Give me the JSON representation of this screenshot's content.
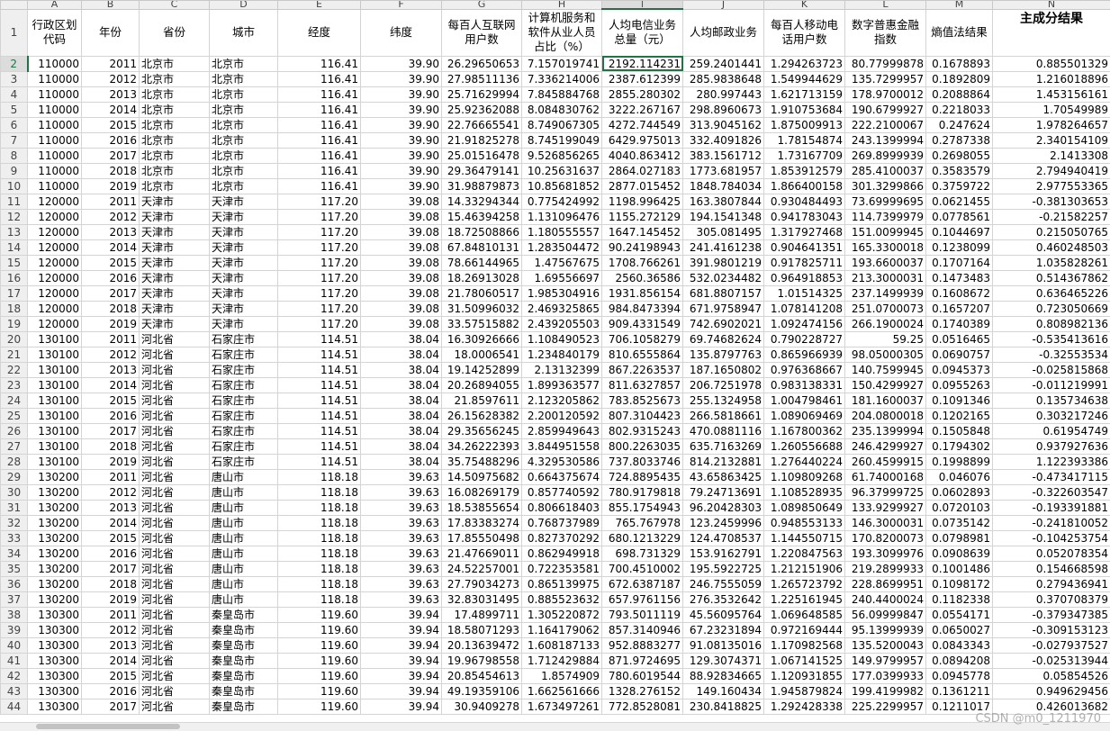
{
  "columns": [
    "",
    "A",
    "B",
    "C",
    "D",
    "E",
    "F",
    "G",
    "H",
    "I",
    "J",
    "K",
    "L",
    "M",
    "N"
  ],
  "selected_column": "I",
  "selected_row": 2,
  "headers": [
    "行政区划代码",
    "年份",
    "省份",
    "城市",
    "经度",
    "纬度",
    "每百人互联网用户数",
    "计算机服务和软件从业人员占比（%）",
    "人均电信业务总量（元）",
    "人均邮政业务",
    "每百人移动电话用户数",
    "数字普惠金融指数",
    "熵值法结果",
    "主成分结果"
  ],
  "rows": [
    [
      "110000",
      "2011",
      "北京市",
      "北京市",
      "116.41",
      "39.90",
      "26.29650653",
      "7.157019741",
      "2192.114231",
      "259.2401441",
      "1.294263723",
      "80.77999878",
      "0.1678893",
      "0.885501329"
    ],
    [
      "110000",
      "2012",
      "北京市",
      "北京市",
      "116.41",
      "39.90",
      "27.98511136",
      "7.336214006",
      "2387.612399",
      "285.9838648",
      "1.549944629",
      "135.7299957",
      "0.1892809",
      "1.216018896"
    ],
    [
      "110000",
      "2013",
      "北京市",
      "北京市",
      "116.41",
      "39.90",
      "25.71629994",
      "7.845884768",
      "2855.280302",
      "280.997443",
      "1.621713159",
      "178.9700012",
      "0.2088864",
      "1.453156161"
    ],
    [
      "110000",
      "2014",
      "北京市",
      "北京市",
      "116.41",
      "39.90",
      "25.92362088",
      "8.084830762",
      "3222.267167",
      "298.8960673",
      "1.910753684",
      "190.6799927",
      "0.2218033",
      "1.70549989"
    ],
    [
      "110000",
      "2015",
      "北京市",
      "北京市",
      "116.41",
      "39.90",
      "22.76665541",
      "8.749067305",
      "4272.744549",
      "313.9045162",
      "1.875009913",
      "222.2100067",
      "0.247624",
      "1.978264657"
    ],
    [
      "110000",
      "2016",
      "北京市",
      "北京市",
      "116.41",
      "39.90",
      "21.91825278",
      "8.745199049",
      "6429.975013",
      "332.4091826",
      "1.78154874",
      "243.1399994",
      "0.2787338",
      "2.340154109"
    ],
    [
      "110000",
      "2017",
      "北京市",
      "北京市",
      "116.41",
      "39.90",
      "25.01516478",
      "9.526856265",
      "4040.863412",
      "383.1561712",
      "1.73167709",
      "269.8999939",
      "0.2698055",
      "2.1413308"
    ],
    [
      "110000",
      "2018",
      "北京市",
      "北京市",
      "116.41",
      "39.90",
      "29.36479141",
      "10.25631637",
      "2864.027183",
      "1773.681957",
      "1.853912579",
      "285.4100037",
      "0.3583579",
      "2.794940419"
    ],
    [
      "110000",
      "2019",
      "北京市",
      "北京市",
      "116.41",
      "39.90",
      "31.98879873",
      "10.85681852",
      "2877.015452",
      "1848.784034",
      "1.866400158",
      "301.3299866",
      "0.3759722",
      "2.977553365"
    ],
    [
      "120000",
      "2011",
      "天津市",
      "天津市",
      "117.20",
      "39.08",
      "14.33294344",
      "0.775424992",
      "1198.996425",
      "163.3807844",
      "0.930484493",
      "73.69999695",
      "0.0621455",
      "-0.381303653"
    ],
    [
      "120000",
      "2012",
      "天津市",
      "天津市",
      "117.20",
      "39.08",
      "15.46394258",
      "1.131096476",
      "1155.272129",
      "194.1541348",
      "0.941783043",
      "114.7399979",
      "0.0778561",
      "-0.21582257"
    ],
    [
      "120000",
      "2013",
      "天津市",
      "天津市",
      "117.20",
      "39.08",
      "18.72508866",
      "1.180555557",
      "1647.145452",
      "305.081495",
      "1.317927468",
      "151.0099945",
      "0.1044697",
      "0.215050765"
    ],
    [
      "120000",
      "2014",
      "天津市",
      "天津市",
      "117.20",
      "39.08",
      "67.84810131",
      "1.283504472",
      "90.24198943",
      "241.4161238",
      "0.904641351",
      "165.3300018",
      "0.1238099",
      "0.460248503"
    ],
    [
      "120000",
      "2015",
      "天津市",
      "天津市",
      "117.20",
      "39.08",
      "78.66144965",
      "1.47567675",
      "1708.766261",
      "391.9801219",
      "0.917825711",
      "193.6600037",
      "0.1707164",
      "1.035828261"
    ],
    [
      "120000",
      "2016",
      "天津市",
      "天津市",
      "117.20",
      "39.08",
      "18.26913028",
      "1.69556697",
      "2560.36586",
      "532.0234482",
      "0.964918853",
      "213.3000031",
      "0.1473483",
      "0.514367862"
    ],
    [
      "120000",
      "2017",
      "天津市",
      "天津市",
      "117.20",
      "39.08",
      "21.78060517",
      "1.985304916",
      "1931.856154",
      "681.8807157",
      "1.01514325",
      "237.1499939",
      "0.1608672",
      "0.636465226"
    ],
    [
      "120000",
      "2018",
      "天津市",
      "天津市",
      "117.20",
      "39.08",
      "31.50996032",
      "2.469325865",
      "984.8473394",
      "671.9758947",
      "1.078141208",
      "251.0700073",
      "0.1657207",
      "0.723050669"
    ],
    [
      "120000",
      "2019",
      "天津市",
      "天津市",
      "117.20",
      "39.08",
      "33.57515882",
      "2.439205503",
      "909.4331549",
      "742.6902021",
      "1.092474156",
      "266.1900024",
      "0.1740389",
      "0.808982136"
    ],
    [
      "130100",
      "2011",
      "河北省",
      "石家庄市",
      "114.51",
      "38.04",
      "16.30926666",
      "1.108490523",
      "706.1058279",
      "69.74682624",
      "0.790228727",
      "59.25",
      "0.0516465",
      "-0.535413616"
    ],
    [
      "130100",
      "2012",
      "河北省",
      "石家庄市",
      "114.51",
      "38.04",
      "18.0006541",
      "1.234840179",
      "810.6555864",
      "135.8797763",
      "0.865966939",
      "98.05000305",
      "0.0690757",
      "-0.32553534"
    ],
    [
      "130100",
      "2013",
      "河北省",
      "石家庄市",
      "114.51",
      "38.04",
      "19.14252899",
      "2.13132399",
      "867.2263537",
      "187.1650802",
      "0.976368667",
      "140.7599945",
      "0.0945373",
      "-0.025815868"
    ],
    [
      "130100",
      "2014",
      "河北省",
      "石家庄市",
      "114.51",
      "38.04",
      "20.26894055",
      "1.899363577",
      "811.6327857",
      "206.7251978",
      "0.983138331",
      "150.4299927",
      "0.0955263",
      "-0.011219991"
    ],
    [
      "130100",
      "2015",
      "河北省",
      "石家庄市",
      "114.51",
      "38.04",
      "21.8597611",
      "2.123205862",
      "783.8525673",
      "255.1324958",
      "1.004798461",
      "181.1600037",
      "0.1091346",
      "0.135734638"
    ],
    [
      "130100",
      "2016",
      "河北省",
      "石家庄市",
      "114.51",
      "38.04",
      "26.15628382",
      "2.200120592",
      "807.3104423",
      "266.5818661",
      "1.089069469",
      "204.0800018",
      "0.1202165",
      "0.303217246"
    ],
    [
      "130100",
      "2017",
      "河北省",
      "石家庄市",
      "114.51",
      "38.04",
      "29.35656245",
      "2.859949643",
      "802.9315243",
      "470.0881116",
      "1.167800362",
      "235.1399994",
      "0.1505848",
      "0.61954749"
    ],
    [
      "130100",
      "2018",
      "河北省",
      "石家庄市",
      "114.51",
      "38.04",
      "34.26222393",
      "3.844951558",
      "800.2263035",
      "635.7163269",
      "1.260556688",
      "246.4299927",
      "0.1794302",
      "0.937927636"
    ],
    [
      "130100",
      "2019",
      "河北省",
      "石家庄市",
      "114.51",
      "38.04",
      "35.75488296",
      "4.329530586",
      "737.8033746",
      "814.2132881",
      "1.276440224",
      "260.4599915",
      "0.1998899",
      "1.122393386"
    ],
    [
      "130200",
      "2011",
      "河北省",
      "唐山市",
      "118.18",
      "39.63",
      "14.50975682",
      "0.664375674",
      "724.8895435",
      "43.65863425",
      "1.109809268",
      "61.74000168",
      "0.046076",
      "-0.473417115"
    ],
    [
      "130200",
      "2012",
      "河北省",
      "唐山市",
      "118.18",
      "39.63",
      "16.08269179",
      "0.857740592",
      "780.9179818",
      "79.24713691",
      "1.108528935",
      "96.37999725",
      "0.0602893",
      "-0.322603547"
    ],
    [
      "130200",
      "2013",
      "河北省",
      "唐山市",
      "118.18",
      "39.63",
      "18.53855654",
      "0.806618403",
      "855.1754943",
      "96.20428303",
      "1.089850649",
      "133.9299927",
      "0.0720103",
      "-0.193391881"
    ],
    [
      "130200",
      "2014",
      "河北省",
      "唐山市",
      "118.18",
      "39.63",
      "17.83383274",
      "0.768737989",
      "765.767978",
      "123.2459996",
      "0.948553133",
      "146.3000031",
      "0.0735142",
      "-0.241810052"
    ],
    [
      "130200",
      "2015",
      "河北省",
      "唐山市",
      "118.18",
      "39.63",
      "17.85550498",
      "0.827370292",
      "680.1213229",
      "124.4708537",
      "1.144550715",
      "170.8200073",
      "0.0798981",
      "-0.104253754"
    ],
    [
      "130200",
      "2016",
      "河北省",
      "唐山市",
      "118.18",
      "39.63",
      "21.47669011",
      "0.862949918",
      "698.731329",
      "153.9162791",
      "1.220847563",
      "193.3099976",
      "0.0908639",
      "0.052078354"
    ],
    [
      "130200",
      "2017",
      "河北省",
      "唐山市",
      "118.18",
      "39.63",
      "24.52257001",
      "0.722353581",
      "700.4510002",
      "195.5922725",
      "1.212151906",
      "219.2899933",
      "0.1001486",
      "0.154668598"
    ],
    [
      "130200",
      "2018",
      "河北省",
      "唐山市",
      "118.18",
      "39.63",
      "27.79034273",
      "0.865139975",
      "672.6387187",
      "246.7555059",
      "1.265723792",
      "228.8699951",
      "0.1098172",
      "0.279436941"
    ],
    [
      "130200",
      "2019",
      "河北省",
      "唐山市",
      "118.18",
      "39.63",
      "32.83031495",
      "0.885523632",
      "657.9761156",
      "276.3532642",
      "1.225161945",
      "240.4400024",
      "0.1182338",
      "0.370708379"
    ],
    [
      "130300",
      "2011",
      "河北省",
      "秦皇岛市",
      "119.60",
      "39.94",
      "17.4899711",
      "1.305220872",
      "793.5011119",
      "45.56095764",
      "1.069648585",
      "56.09999847",
      "0.0554171",
      "-0.379347385"
    ],
    [
      "130300",
      "2012",
      "河北省",
      "秦皇岛市",
      "119.60",
      "39.94",
      "18.58071293",
      "1.164179062",
      "857.3140946",
      "67.23231894",
      "0.972169444",
      "95.13999939",
      "0.0650027",
      "-0.309153123"
    ],
    [
      "130300",
      "2013",
      "河北省",
      "秦皇岛市",
      "119.60",
      "39.94",
      "20.13639472",
      "1.608187133",
      "952.8883277",
      "91.08135016",
      "1.170982568",
      "135.5200043",
      "0.0843343",
      "-0.027937527"
    ],
    [
      "130300",
      "2014",
      "河北省",
      "秦皇岛市",
      "119.60",
      "39.94",
      "19.96798558",
      "1.712429884",
      "871.9724695",
      "129.3074371",
      "1.067141525",
      "149.9799957",
      "0.0894208",
      "-0.025313944"
    ],
    [
      "130300",
      "2015",
      "河北省",
      "秦皇岛市",
      "119.60",
      "39.94",
      "20.85454613",
      "1.8574909",
      "780.6019544",
      "88.92834665",
      "1.120931855",
      "177.0399933",
      "0.0945778",
      "0.05854526"
    ],
    [
      "130300",
      "2016",
      "河北省",
      "秦皇岛市",
      "119.60",
      "39.94",
      "49.19359106",
      "1.662561666",
      "1328.276152",
      "149.160434",
      "1.945879824",
      "199.4199982",
      "0.1361211",
      "0.949629456"
    ],
    [
      "130300",
      "2017",
      "河北省",
      "秦皇岛市",
      "119.60",
      "39.94",
      "30.9409278",
      "1.673497261",
      "772.8528081",
      "230.8418825",
      "1.292428338",
      "225.2299957",
      "0.1211017",
      "0.426013682"
    ]
  ],
  "watermark": "CSDN @m0_1211970"
}
